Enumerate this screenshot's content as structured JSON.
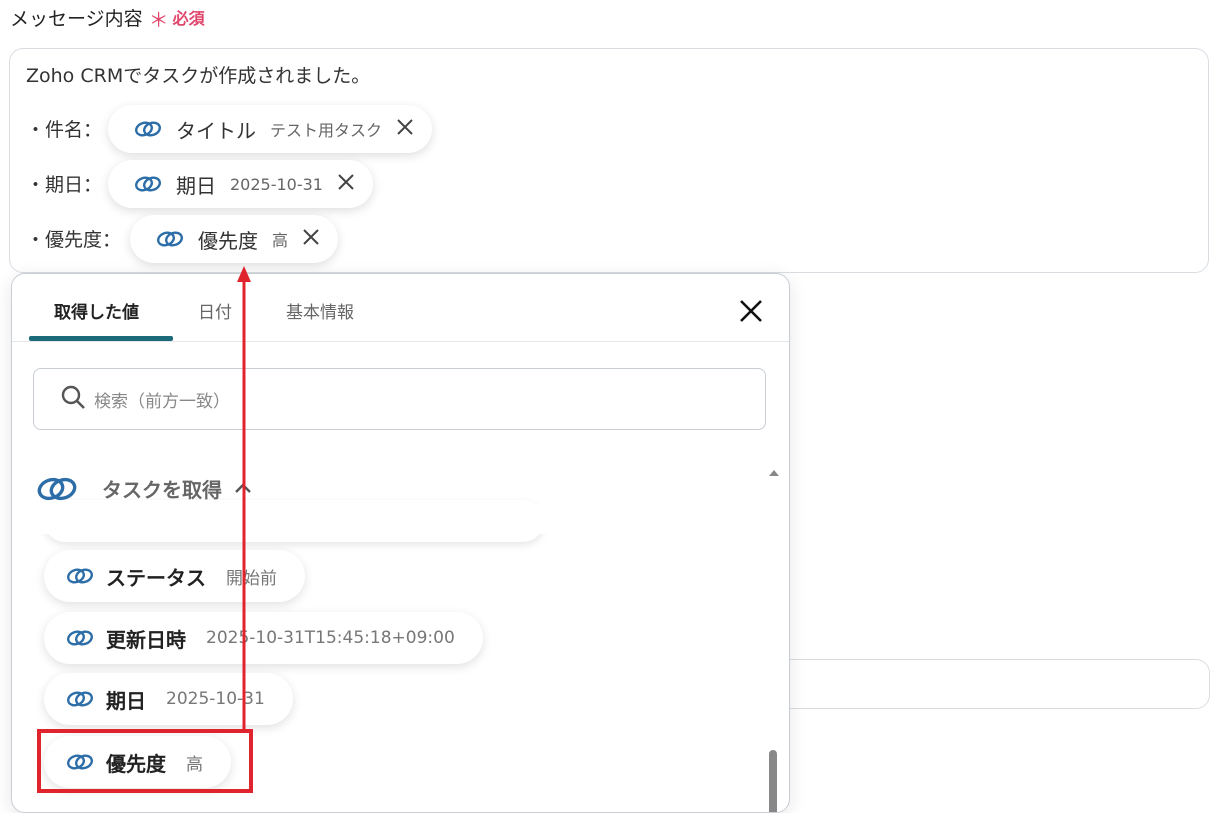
{
  "field": {
    "label": "メッセージ内容",
    "required_mark": "＊",
    "required_text": "必須"
  },
  "message": {
    "first_line": "Zoho CRMでタスクが作成されました。",
    "lines": [
      {
        "prefix": "・件名：",
        "token_name": "タイトル",
        "token_value": "テスト用タスク"
      },
      {
        "prefix": "・期日：",
        "token_name": "期日",
        "token_value": "2025-10-31"
      },
      {
        "prefix": "・優先度：",
        "token_name": "優先度",
        "token_value": "高"
      }
    ]
  },
  "panel": {
    "tabs": [
      "取得した値",
      "日付",
      "基本情報"
    ],
    "active_tab": "取得した値",
    "search_placeholder": "検索（前方一致）",
    "group_title": "タスクを取得",
    "items": [
      {
        "name": "ステータス",
        "value": "開始前"
      },
      {
        "name": "更新日時",
        "value": "2025-10-31T15:45:18+09:00"
      },
      {
        "name": "期日",
        "value": "2025-10-31"
      },
      {
        "name": "優先度",
        "value": "高"
      }
    ]
  },
  "colors": {
    "required": "#e0466b",
    "tab_underline": "#1d6a7a",
    "zoho_icon": "#2d6ea8",
    "annotation": "#e0242e"
  },
  "icons": [
    "zoho-link-icon",
    "close-icon",
    "search-icon",
    "chevron-up-icon"
  ]
}
